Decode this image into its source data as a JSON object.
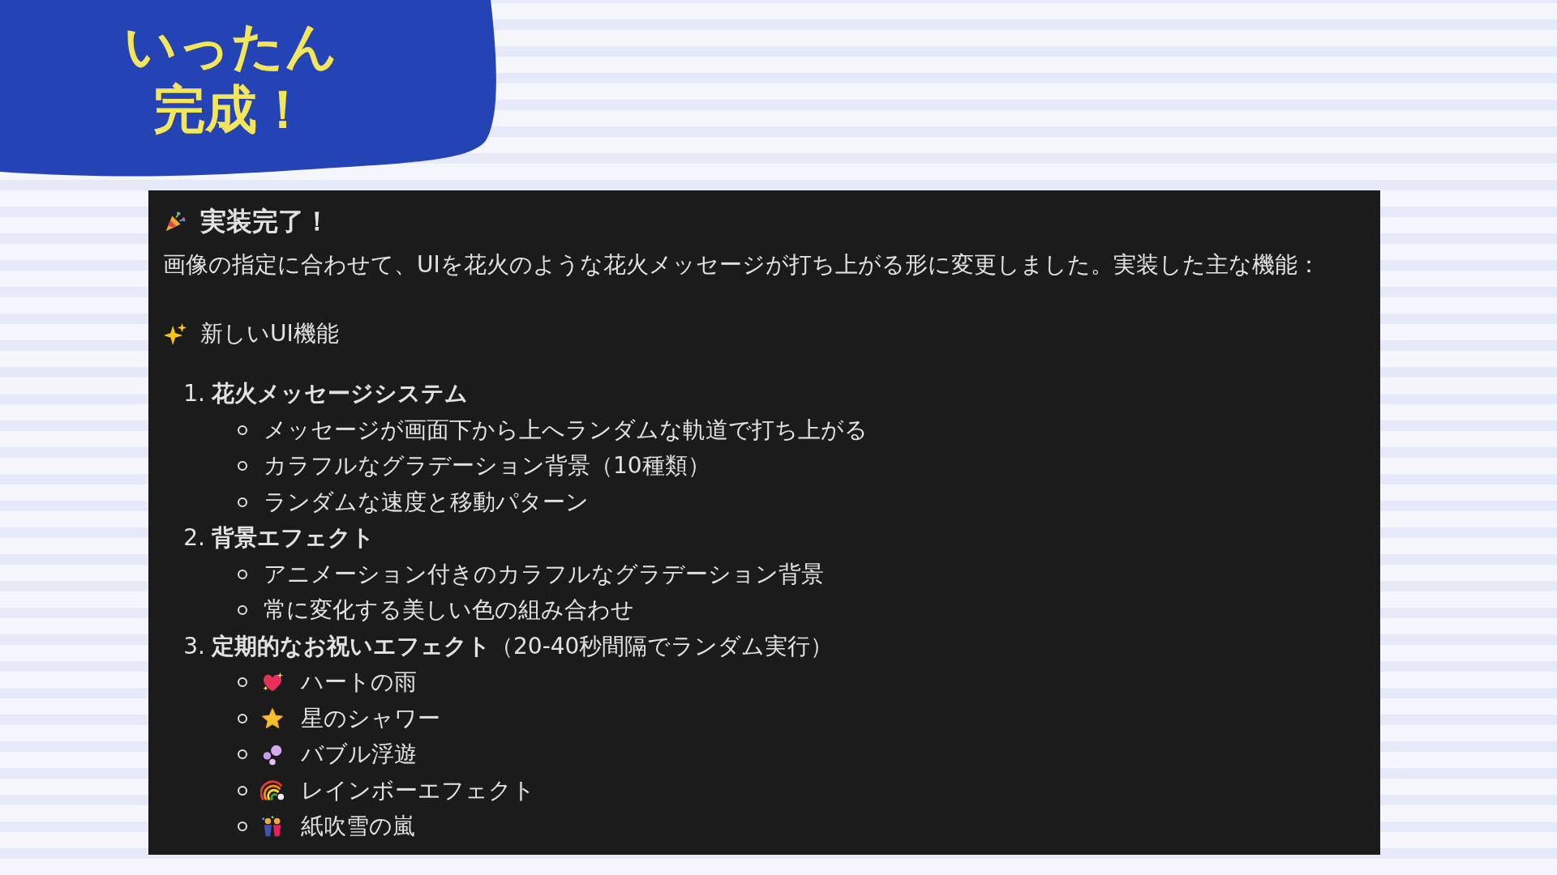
{
  "banner": {
    "lines": [
      "いったん",
      "完成！"
    ]
  },
  "message": {
    "title": "実装完了！",
    "intro": "画像の指定に合わせて、UIを花火のような花火メッセージが打ち上がる形に変更しました。実装した主な機能：",
    "section": "新しいUI機能",
    "features": [
      {
        "number": "1.",
        "title": "**花火メッセージシステム**",
        "items": [
          {
            "kind": "plain",
            "text": "メッセージが画面下から上へランダムな軌道で打ち上がる"
          },
          {
            "kind": "plain",
            "text": "カラフルなグラデーション背景（10種類）"
          },
          {
            "kind": "plain",
            "text": "ランダムな速度と移動パターン"
          }
        ]
      },
      {
        "number": "2.",
        "title": "**背景エフェクト**",
        "items": [
          {
            "kind": "plain",
            "text": "アニメーション付きのカラフルなグラデーション背景"
          },
          {
            "kind": "plain",
            "text": "常に変化する美しい色の組み合わせ"
          }
        ]
      },
      {
        "number": "3.",
        "title": "**定期的なお祝いエフェクト**（20-40秒間隔でランダム実行）",
        "items": [
          {
            "kind": "emoji",
            "text": "ハートの雨"
          },
          {
            "kind": "emoji",
            "text": "星のシャワー"
          },
          {
            "kind": "emoji",
            "text": "バブル浮遊"
          },
          {
            "kind": "emoji",
            "text": "レインボーエフェクト"
          },
          {
            "kind": "emoji",
            "text": "紙吹雪の嵐"
          }
        ]
      }
    ]
  }
}
